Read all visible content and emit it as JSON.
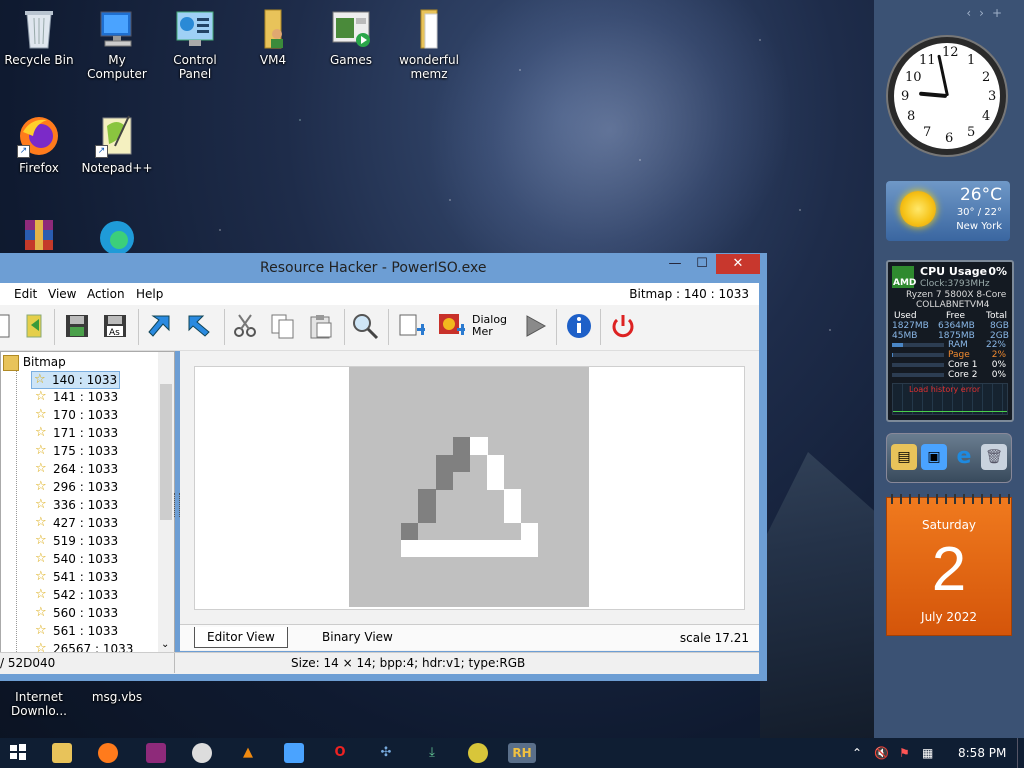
{
  "desktop": {
    "icons": [
      {
        "label": "Recycle Bin",
        "icon": "recycle-bin-icon"
      },
      {
        "label": "My Computer",
        "icon": "computer-icon"
      },
      {
        "label": "Control Panel",
        "icon": "control-panel-icon"
      },
      {
        "label": "VM4",
        "icon": "user-folder-icon"
      },
      {
        "label": "Games",
        "icon": "games-icon"
      },
      {
        "label": "wonderful memz",
        "icon": "folder-icon"
      },
      {
        "label": "Firefox",
        "icon": "firefox-icon"
      },
      {
        "label": "Notepad++",
        "icon": "notepad-plus-plus-icon"
      },
      {
        "label": "Internet Downlo...",
        "icon": "internet-download-icon"
      },
      {
        "label": "msg.vbs",
        "icon": "script-file-icon"
      }
    ]
  },
  "window": {
    "title": "Resource Hacker - PowerISO.exe",
    "minimize": "—",
    "maximize": "☐",
    "close": "✕",
    "menu": {
      "edit": "Edit",
      "view": "View",
      "action": "Action",
      "help": "Help"
    },
    "menu_status": "Bitmap : 140 : 1033",
    "toolbar": {
      "dialog_label_line1": "Dialog",
      "dialog_label_line2": "Mer"
    },
    "tree": {
      "root": "Bitmap",
      "items": [
        "140 : 1033",
        "141 : 1033",
        "170 : 1033",
        "171 : 1033",
        "175 : 1033",
        "264 : 1033",
        "296 : 1033",
        "336 : 1033",
        "427 : 1033",
        "519 : 1033",
        "540 : 1033",
        "541 : 1033",
        "542 : 1033",
        "560 : 1033",
        "561 : 1033",
        "26567 : 1033"
      ],
      "selected_index": 0
    },
    "tabs": {
      "editor": "Editor View",
      "binary": "Binary View",
      "scale": "scale 17.21"
    },
    "status": {
      "left": "/ 52D040",
      "info": "Size: 14 × 14;  bpp:4;  hdr:v1;  type:RGB"
    }
  },
  "gadgets": {
    "clock": {
      "numbers": [
        "12",
        "1",
        "2",
        "3",
        "4",
        "5",
        "6",
        "7",
        "8",
        "9",
        "10",
        "11"
      ]
    },
    "weather": {
      "temp": "26°C",
      "range": "30° / 22°",
      "city": "New York"
    },
    "cpu": {
      "title": "CPU Usage",
      "percent": "0%",
      "brand": "AMD",
      "clock": "Clock:3793MHz",
      "model": "Ryzen 7 5800X 8-Core",
      "host": "COLLABNETVM4",
      "mem_headers": [
        "Used",
        "Free",
        "Total"
      ],
      "ram_row": [
        "1827MB",
        "6364MB",
        "8GB"
      ],
      "page_row": [
        "45MB",
        "1875MB",
        "2GB"
      ],
      "meters": [
        {
          "label": "RAM",
          "value": "22%",
          "fill": 0.22
        },
        {
          "label": "Page",
          "value": "2%",
          "fill": 0.02
        },
        {
          "label": "Core 1",
          "value": "0%",
          "fill": 0.0
        },
        {
          "label": "Core 2",
          "value": "0%",
          "fill": 0.0
        }
      ],
      "error": "Load history error"
    },
    "calendar": {
      "day": "Saturday",
      "date": "2",
      "month": "July 2022"
    }
  },
  "taskbar": {
    "time": "8:58 PM",
    "apps": [
      "file-explorer-icon",
      "firefox-icon",
      "winrar-icon",
      "cd-player-icon",
      "vlc-icon",
      "control-panel-icon",
      "opera-icon",
      "network-icon",
      "installer-icon",
      "games-icon",
      "resource-hacker-icon"
    ],
    "active_app": "RH"
  },
  "colors": {
    "accent": "#1e6fd9",
    "taskbar": "#0f1e33",
    "calendar": "#e66a12"
  }
}
